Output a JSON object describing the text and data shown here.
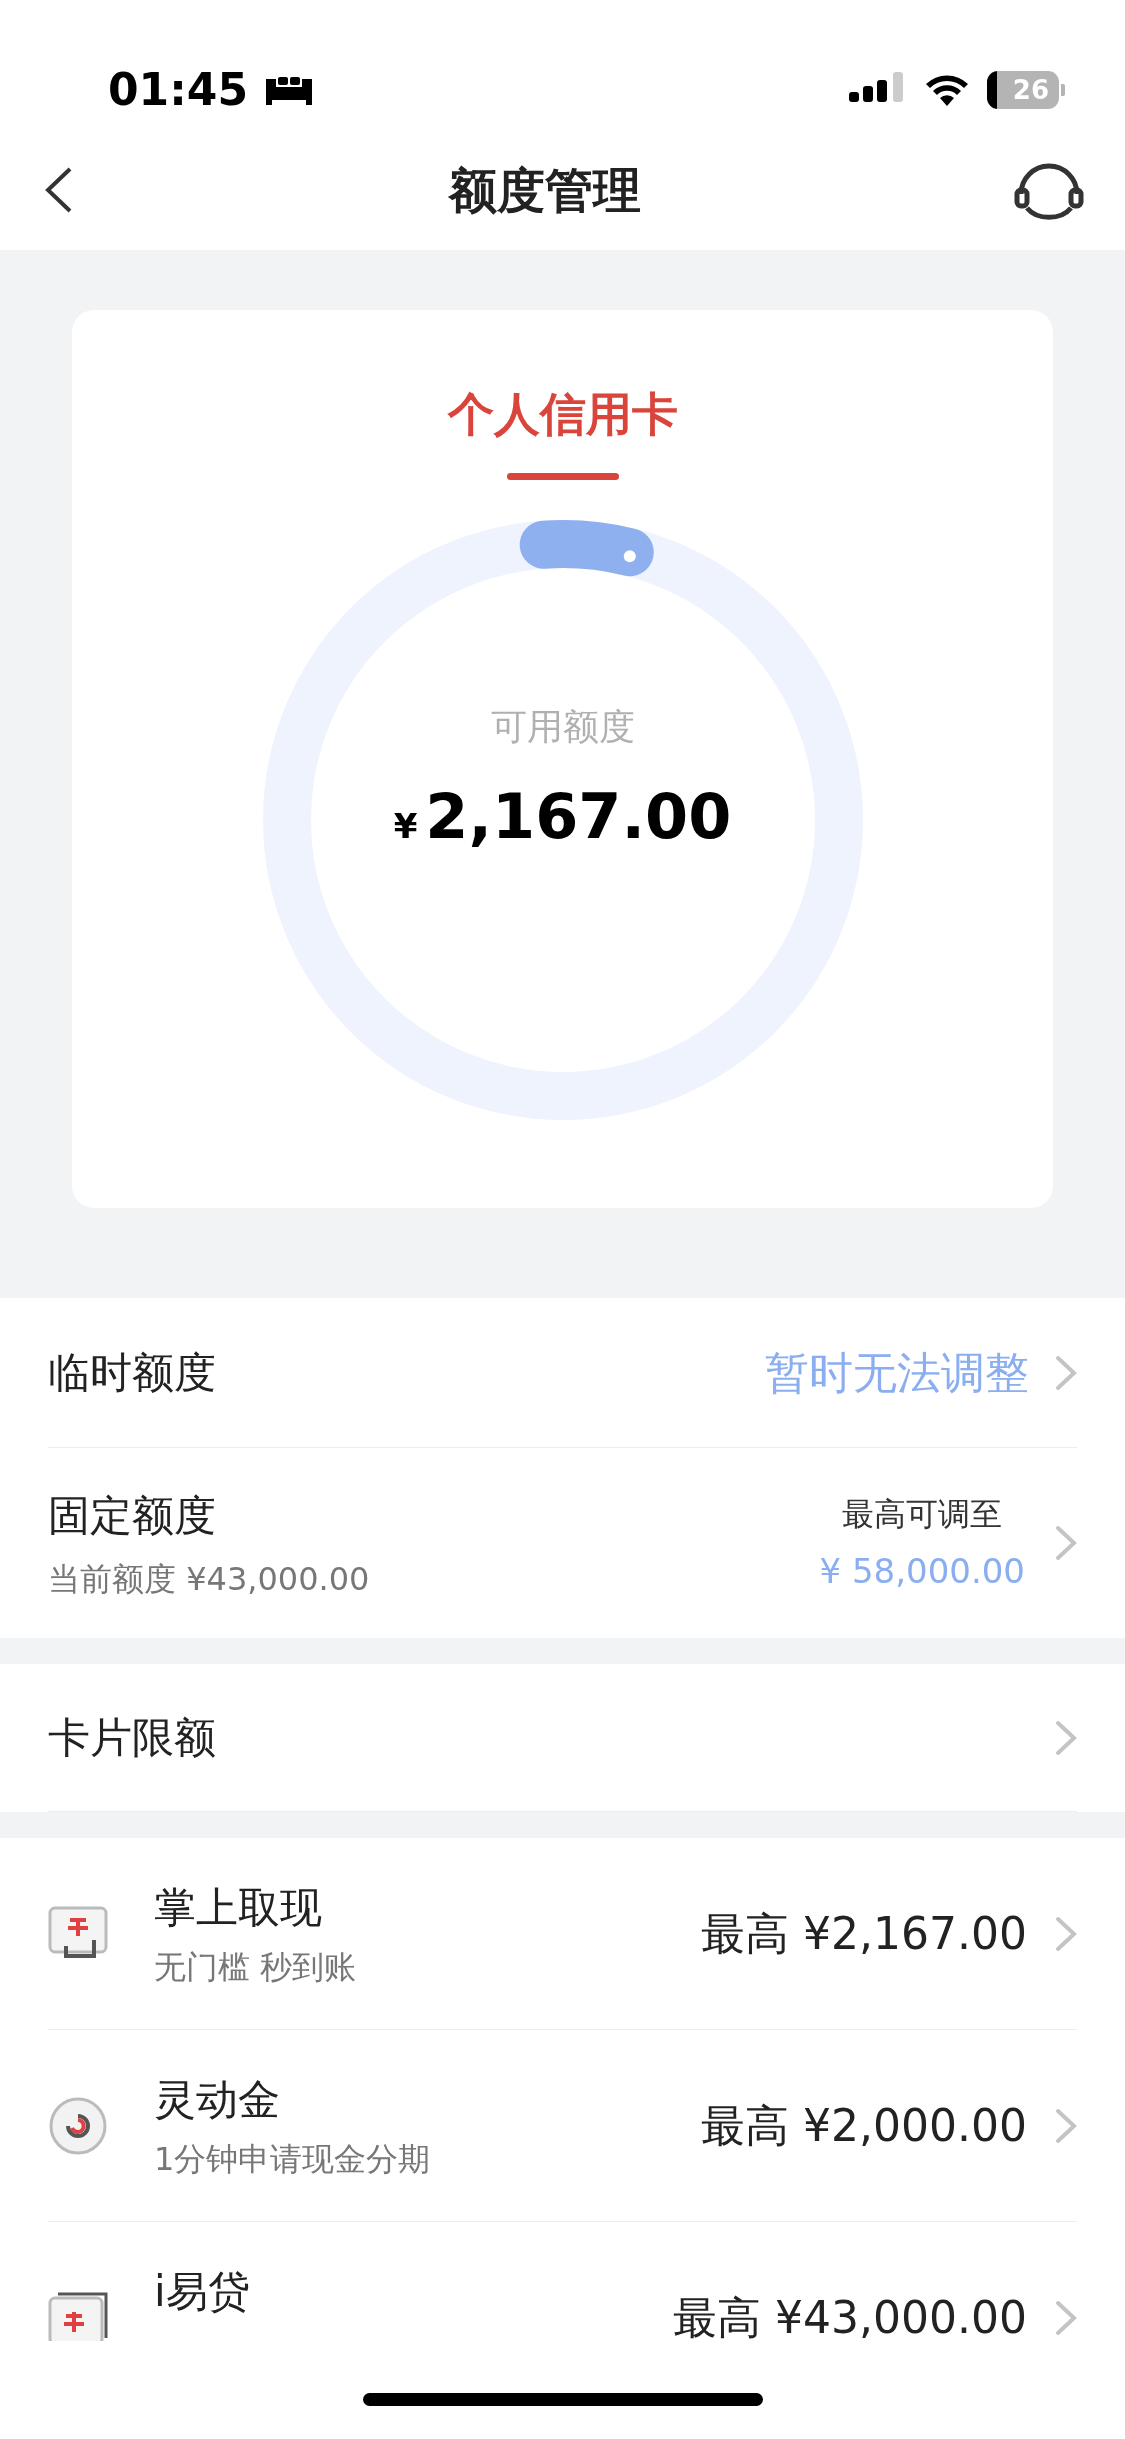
{
  "status_bar": {
    "time": "01:45",
    "battery": "26"
  },
  "nav": {
    "title": "额度管理"
  },
  "card": {
    "title": "个人信用卡",
    "label": "可用额度",
    "currency": "¥",
    "amount": "2,167.00"
  },
  "limit_rows": [
    {
      "kind": "status",
      "title": "临时额度",
      "value": "暂时无法调整"
    },
    {
      "kind": "detail",
      "title": "固定额度",
      "subtitle": "当前额度 ¥43,000.00",
      "value_label": "最高可调至",
      "value": "¥ 58,000.00"
    }
  ],
  "card_limit": {
    "title": "卡片限额"
  },
  "products": [
    {
      "kind": "cash",
      "title": "掌上取现",
      "subtitle": "无门槛 秒到账",
      "amount": "最高 ¥2,167.00"
    },
    {
      "kind": "ring",
      "title": "灵动金",
      "subtitle": "1分钟申请现金分期",
      "amount": "最高 ¥2,000.00"
    },
    {
      "kind": "loan",
      "title": "i易贷",
      "amount": "最高 ¥43,000.00"
    }
  ]
}
